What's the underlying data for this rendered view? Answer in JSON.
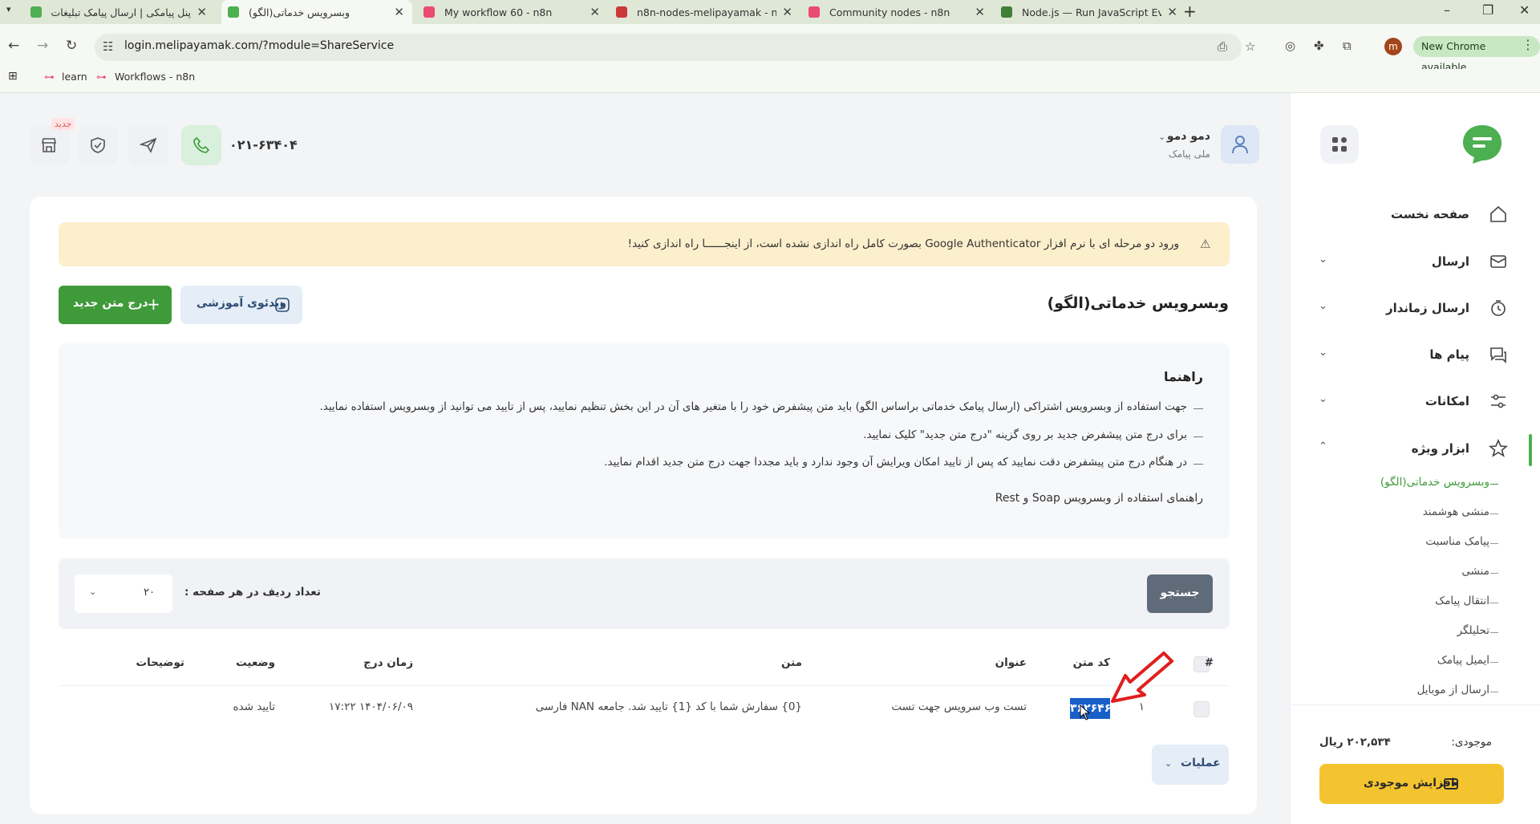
{
  "browser": {
    "tabs": [
      {
        "title": "پنل پیامکی | ارسال پیامک تبلیغات",
        "favicon_color": "#4caf50",
        "active": false
      },
      {
        "title": "وبسرویس خدماتی(الگو)",
        "favicon_color": "#4caf50",
        "active": true
      },
      {
        "title": "My workflow 60 - n8n",
        "favicon_color": "#ea4b71",
        "active": false
      },
      {
        "title": "n8n-nodes-melipayamak - npm",
        "favicon_color": "#cb3837",
        "active": false
      },
      {
        "title": "Community nodes - n8n",
        "favicon_color": "#ea4b71",
        "active": false
      },
      {
        "title": "Node.js — Run JavaScript Every",
        "favicon_color": "#417e38",
        "active": false
      }
    ],
    "url": "login.melipayamak.com/?module=ShareService",
    "profile_initial": "m",
    "update_label": "New Chrome available",
    "bookmarks": [
      "learn",
      "Workflows - n8n"
    ]
  },
  "sidebar": {
    "nav": [
      {
        "label": "صفحه نخست",
        "icon": "home-icon",
        "has_chevron": false
      },
      {
        "label": "ارسال",
        "icon": "send-icon",
        "has_chevron": true
      },
      {
        "label": "ارسال زماندار",
        "icon": "timer-icon",
        "has_chevron": true
      },
      {
        "label": "پیام ها",
        "icon": "messages-icon",
        "has_chevron": true
      },
      {
        "label": "امکانات",
        "icon": "sliders-icon",
        "has_chevron": true
      },
      {
        "label": "ابزار ویژه",
        "icon": "star-icon",
        "has_chevron": true,
        "expanded": true
      }
    ],
    "sub_items": [
      "وبسرویس خدماتی(الگو)",
      "منشی هوشمند",
      "پیامک مناسبت",
      "منشی",
      "انتقال پیامک",
      "تحلیلگر",
      "ایمیل پیامک",
      "ارسال از موبایل"
    ],
    "balance_label": "موجودی:",
    "balance_value": "۲۰۲,۵۳۴ ریال",
    "add_balance_label": "افزایش موجودی"
  },
  "header": {
    "new_badge": "جدید",
    "phone": "۰۲۱-۶۳۴۰۴",
    "user_name": "دمو دمو",
    "user_sub": "ملی پیامک"
  },
  "main": {
    "alert": "ورود دو مرحله ای با نرم افزار Google Authenticator بصورت کامل راه اندازی نشده است، از اینجــــــا راه اندازی کنید!",
    "title": "وبسرویس خدماتی(الگو)",
    "video_label": "ویدئوی آموزشی",
    "add_label": "درج متن جدید",
    "guide": {
      "title": "راهنما",
      "lines": [
        "جهت استفاده از وبسرویس اشتراکی (ارسال پیامک خدماتی براساس الگو) باید متن پیشفرض خود را با متغیر های آن در این بخش تنظیم نمایید، پس از تایید می توانید از وبسرویس استفاده نمایید.",
        "برای درج متن پیشفرض جدید بر روی گزینه \"درج متن جدید\" کلیک نمایید.",
        "در هنگام درج متن پیشفرض دقت نمایید که پس از تایید امکان ویرایش آن وجود ندارد و باید مجددا جهت درج متن جدید اقدام نمایید."
      ],
      "link": "راهنمای استفاده از وبسرویس Soap و Rest"
    },
    "search_label": "جستجو",
    "rows_label": "تعداد ردیف در هر صفحه :",
    "rows_value": "۲۰",
    "table": {
      "headers": {
        "num": "#",
        "code": "کد متن",
        "title": "عنوان",
        "text": "متن",
        "time": "زمان درج",
        "status": "وضعیت",
        "desc": "توضیحات"
      },
      "rows": [
        {
          "num": "۱",
          "code": "۳۶۲۶۴۶",
          "title": "تست وب سرویس جهت تست",
          "text": "{0} سفارش شما با کد {1} تایید شد. جامعه NAN فارسی",
          "time": "۱۴۰۴/۰۶/۰۹ ۱۷:۲۲",
          "status": "تایید شده",
          "desc": ""
        }
      ]
    },
    "ops_label": "عملیات"
  },
  "colors": {
    "brand_green": "#3f9a3a",
    "warning_bg": "#fcefcc",
    "balance_button": "#f4c430",
    "selection": "#1a5fc8",
    "annotation_arrow": "#e11d1d"
  }
}
